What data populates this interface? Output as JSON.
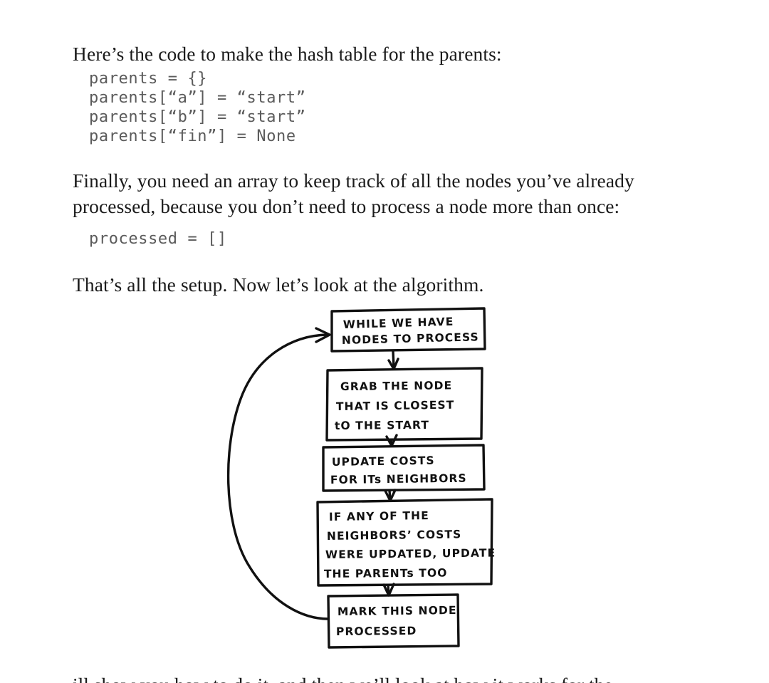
{
  "page": {
    "background_color": "#ffffff",
    "text_color": "#1b1b1b",
    "code_color": "#5b5b5b",
    "ink_color": "#111111"
  },
  "paragraphs": {
    "intro": "Here’s the code to make the hash table for the parents:",
    "finally": "Finally, you need an array to keep track of all the nodes you’ve already processed, because you don’t need to process a node more than once:",
    "setup": "That’s all the setup. Now let’s look at the algorithm.",
    "clipped_bottom": "ill show you how to do it, and then we’ll look at how it works for the"
  },
  "code_blocks": {
    "parents": "parents = {}\nparents[“a”] = “start”\nparents[“b”] = “start”\nparents[“fin”] = None",
    "processed": "processed = []"
  },
  "flowchart": {
    "style": "hand-drawn",
    "loop_arrow_label": "loop back to top",
    "boxes": [
      {
        "id": "while-nodes",
        "lines": [
          "WHILE  WE HAVE",
          "NODES TO PROCESS"
        ]
      },
      {
        "id": "grab-node",
        "lines": [
          "GRAB THE NODE",
          "THAT  IS CLOSEST",
          "tO THE  START"
        ]
      },
      {
        "id": "update-costs",
        "lines": [
          "UPDATE COSTS",
          "FOR ITs NEIGHBORS"
        ]
      },
      {
        "id": "update-parents",
        "lines": [
          "IF ANY OF THE",
          "NEIGHBORS’ COSTS",
          "WERE UPDATED, UPDATE",
          "THE PARENTs TOO"
        ]
      },
      {
        "id": "mark-processed",
        "lines": [
          "MARK THIS NODE",
          "PROCESSED"
        ]
      }
    ]
  }
}
